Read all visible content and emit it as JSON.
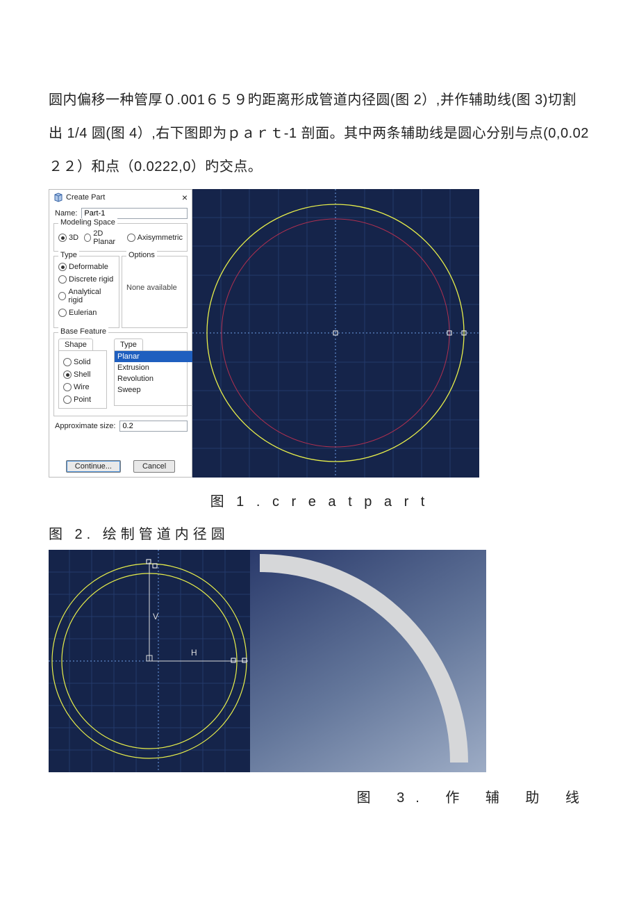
{
  "para": "圆内偏移一种管厚０.001６５９旳距离形成管道内径圆(图 2）,并作辅助线(图 3)切割出 1/4 圆(图 4）,右下图即为ｐａｒｔ‐1 剖面。其中两条辅助线是圆心分别与点(0,0.02２２）和点（0.0222,0）旳交点。",
  "cap1": "图 1 . c r e a t     p a r t",
  "cap2": "图 2.    绘制管道内径圆",
  "cap3": "图   3.   作   辅   助   线",
  "dialog": {
    "title": "Create Part",
    "close": "×",
    "name_label": "Name:",
    "name_value": "Part-1",
    "modeling_legend": "Modeling Space",
    "ms_3d": "3D",
    "ms_2d": "2D Planar",
    "ms_ax": "Axisymmetric",
    "type_legend": "Type",
    "type_deformable": "Deformable",
    "type_discrete": "Discrete rigid",
    "type_analytic": "Analytical rigid",
    "type_euler": "Eulerian",
    "options_legend": "Options",
    "options_none": "None available",
    "base_legend": "Base Feature",
    "shape_tab": "Shape",
    "type_tab": "Type",
    "shape_solid": "Solid",
    "shape_shell": "Shell",
    "shape_wire": "Wire",
    "shape_point": "Point",
    "bf_planar": "Planar",
    "bf_extrusion": "Extrusion",
    "bf_revolution": "Revolution",
    "bf_sweep": "Sweep",
    "approx_label": "Approximate size:",
    "approx_value": "0.2",
    "btn_continue": "Continue...",
    "btn_cancel": "Cancel"
  },
  "sketch": {
    "V": "V",
    "H": "H"
  }
}
